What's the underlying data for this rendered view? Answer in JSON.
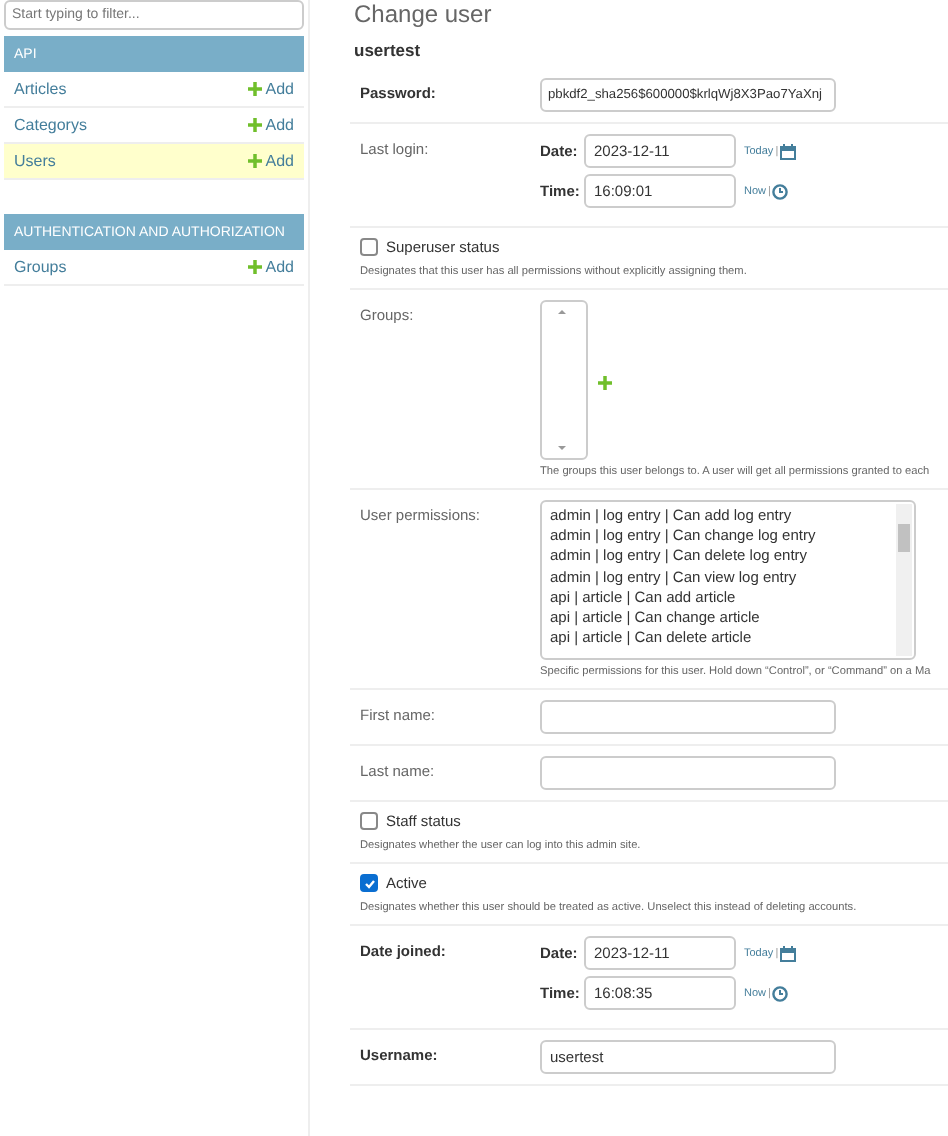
{
  "filter": {
    "placeholder": "Start typing to filter..."
  },
  "sidebar": [
    {
      "title": "API",
      "models": [
        {
          "name": "Articles",
          "add": "Add",
          "selected": false
        },
        {
          "name": "Categorys",
          "add": "Add",
          "selected": false
        },
        {
          "name": "Users",
          "add": "Add",
          "selected": true
        }
      ]
    },
    {
      "title": "AUTHENTICATION AND AUTHORIZATION",
      "models": [
        {
          "name": "Groups",
          "add": "Add",
          "selected": false
        }
      ]
    }
  ],
  "page_title": "Change user",
  "object_name": "usertest",
  "fields": [
    {
      "kind": "text",
      "label": "Password:",
      "required": true,
      "value": "pbkdf2_sha256$600000$krlqWj8X3Pao7YaXnj"
    },
    {
      "kind": "datetime",
      "label": "Last login:",
      "required": false,
      "date_label": "Date:",
      "date": "2023-12-11",
      "today": "Today",
      "time_label": "Time:",
      "time": "16:09:01",
      "now": "Now",
      "separator": "|"
    },
    {
      "kind": "checkbox",
      "label": "Superuser status",
      "checked": false,
      "help": "Designates that this user has all permissions without explicitly assigning them."
    },
    {
      "kind": "select",
      "label": "Groups:",
      "required": false,
      "help": "The groups this user belongs to. A user will get all permissions granted to each"
    },
    {
      "kind": "multiselect",
      "label": "User permissions:",
      "required": false,
      "options": [
        "admin | log entry | Can add log entry",
        "admin | log entry | Can change log entry",
        "admin | log entry | Can delete log entry",
        "admin | log entry | Can view log entry",
        "api | article | Can add article",
        "api | article | Can change article",
        "api | article | Can delete article"
      ],
      "help": "Specific permissions for this user. Hold down “Control”, or “Command” on a Ma"
    },
    {
      "kind": "text",
      "label": "First name:",
      "required": false
    },
    {
      "kind": "text",
      "label": "Last name:",
      "required": false
    },
    {
      "kind": "checkbox",
      "label": "Staff status",
      "checked": false,
      "help": "Designates whether the user can log into this admin site."
    },
    {
      "kind": "checkbox",
      "label": "Active",
      "checked": true,
      "help": "Designates whether this user should be treated as active. Unselect this instead of deleting accounts."
    },
    {
      "kind": "datetime",
      "label": "Date joined:",
      "required": true,
      "date_label": "Date:",
      "date": "2023-12-11",
      "today": "Today",
      "time_label": "Time:",
      "time": "16:08:35",
      "now": "Now",
      "separator": "|"
    },
    {
      "kind": "text",
      "label": "Username:",
      "required": true,
      "value": "usertest"
    }
  ]
}
